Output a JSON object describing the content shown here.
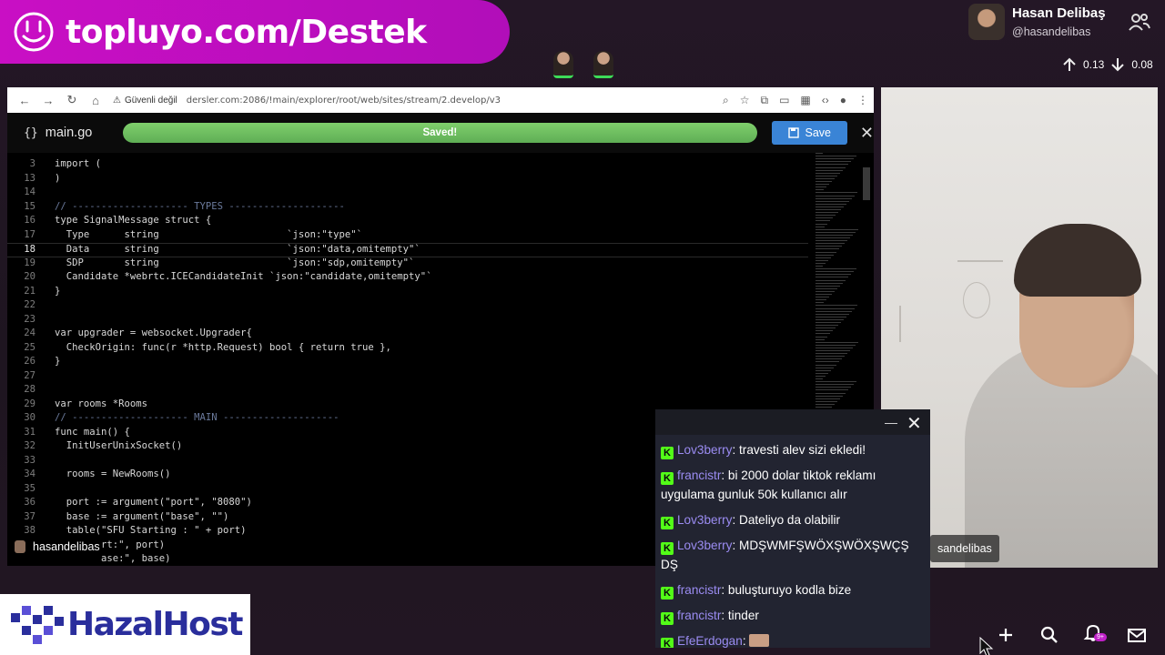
{
  "banner": {
    "text": "topluyo.com/Destek"
  },
  "profile": {
    "name": "Hasan Delibaş",
    "handle": "@hasandelibas"
  },
  "network": {
    "up": "0.13",
    "down": "0.08"
  },
  "browser": {
    "not_secure": "Güvenli değil",
    "url": "dersler.com:2086/!main/explorer/root/web/sites/stream/2.develop/v3"
  },
  "editor": {
    "file_icon": "{}",
    "file_name": "main.go",
    "status": "Saved!",
    "save_label": "Save",
    "lines": [
      {
        "n": "3",
        "code": "import ("
      },
      {
        "n": "13",
        "code": ")"
      },
      {
        "n": "14",
        "code": ""
      },
      {
        "n": "15",
        "code": "// -------------------- TYPES --------------------"
      },
      {
        "n": "16",
        "code": "type SignalMessage struct {"
      },
      {
        "n": "17",
        "code": "  Type      string                      `json:\"type\"`"
      },
      {
        "n": "18",
        "code": "  Data      string                      `json:\"data,omitempty\"`"
      },
      {
        "n": "19",
        "code": "  SDP       string                      `json:\"sdp,omitempty\"`"
      },
      {
        "n": "20",
        "code": "  Candidate *webrtc.ICECandidateInit `json:\"candidate,omitempty\"`"
      },
      {
        "n": "21",
        "code": "}"
      },
      {
        "n": "22",
        "code": ""
      },
      {
        "n": "23",
        "code": ""
      },
      {
        "n": "24",
        "code": "var upgrader = websocket.Upgrader{"
      },
      {
        "n": "25",
        "code": "  CheckOrigin: func(r *http.Request) bool { return true },"
      },
      {
        "n": "26",
        "code": "}"
      },
      {
        "n": "27",
        "code": ""
      },
      {
        "n": "28",
        "code": ""
      },
      {
        "n": "29",
        "code": "var rooms *Rooms"
      },
      {
        "n": "30",
        "code": "// -------------------- MAIN --------------------"
      },
      {
        "n": "31",
        "code": "func main() {"
      },
      {
        "n": "32",
        "code": "  InitUserUnixSocket()"
      },
      {
        "n": "33",
        "code": ""
      },
      {
        "n": "34",
        "code": "  rooms = NewRooms()"
      },
      {
        "n": "35",
        "code": ""
      },
      {
        "n": "36",
        "code": "  port := argument(\"port\", \"8080\")"
      },
      {
        "n": "37",
        "code": "  base := argument(\"base\", \"\")"
      },
      {
        "n": "38",
        "code": "  table(\"SFU Starting : \" + port)"
      },
      {
        "n": "",
        "code": "        rt:\", port)"
      },
      {
        "n": "",
        "code": "        ase:\", base)"
      }
    ]
  },
  "streamer_tag": "hasandelibas",
  "cam_tag": "sandelibas",
  "chat": {
    "messages": [
      {
        "user": "Lov3berry",
        "text": "travesti alev sizi ekledi!"
      },
      {
        "user": "francistr",
        "text": "bi 2000 dolar tiktok reklamı uygulama gunluk 50k kullanıcı alır"
      },
      {
        "user": "Lov3berry",
        "text": "Dateliyo da olabilir"
      },
      {
        "user": "Lov3berry",
        "text": "MDŞWMFŞWÖXŞWÖXŞWÇŞ DŞ"
      },
      {
        "user": "francistr",
        "text": "buluşturuyo kodla bize"
      },
      {
        "user": "francistr",
        "text": "tinder"
      },
      {
        "user": "EfeErdogan",
        "text": ""
      }
    ]
  },
  "sponsor": {
    "text": "HazalHost"
  },
  "notifications": {
    "badge": "9+"
  },
  "colors": {
    "banner": "#c90fc4",
    "kick_green": "#53fc18",
    "chat_user": "#9b8cf2",
    "save_button": "#3a84d6"
  }
}
